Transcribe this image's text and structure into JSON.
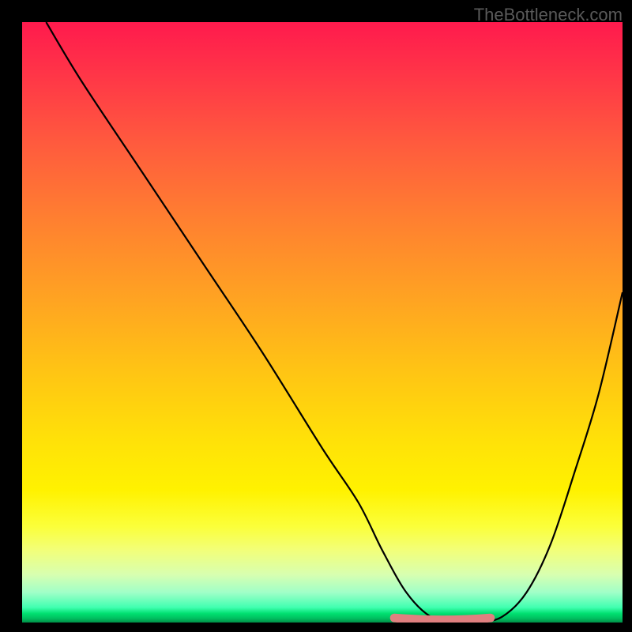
{
  "watermark": "TheBottleneck.com",
  "chart_data": {
    "type": "line",
    "title": "",
    "xlabel": "",
    "ylabel": "",
    "xlim": [
      0,
      100
    ],
    "ylim": [
      0,
      100
    ],
    "series": [
      {
        "name": "bottleneck-curve",
        "x": [
          4,
          10,
          20,
          30,
          40,
          50,
          56,
          60,
          64,
          68,
          72,
          76,
          80,
          84,
          88,
          92,
          96,
          100
        ],
        "y": [
          100,
          90,
          75,
          60,
          45,
          29,
          20,
          12,
          5,
          1,
          0,
          0,
          1,
          5,
          13,
          25,
          38,
          55
        ]
      }
    ],
    "highlight": {
      "name": "optimal-zone",
      "x_range": [
        62,
        78
      ],
      "y": 0.5
    },
    "background_gradient": [
      {
        "pos": 0,
        "color": "#ff1a4d"
      },
      {
        "pos": 50,
        "color": "#ffc414"
      },
      {
        "pos": 80,
        "color": "#fff200"
      },
      {
        "pos": 98,
        "color": "#40ffb0"
      },
      {
        "pos": 100,
        "color": "#009048"
      }
    ]
  }
}
